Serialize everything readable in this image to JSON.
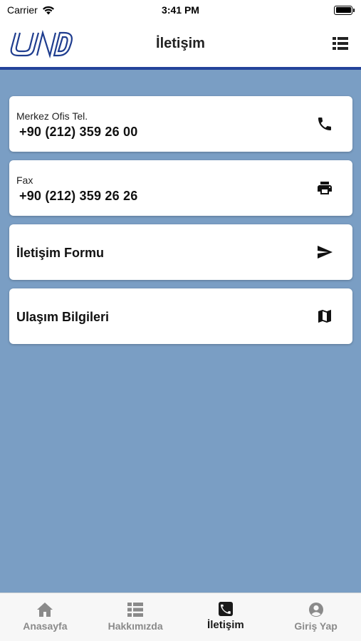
{
  "status_bar": {
    "carrier": "Carrier",
    "time": "3:41 PM"
  },
  "header": {
    "title": "İletişim",
    "logo_icon": "und-logo",
    "menu_icon": "list-icon",
    "accent_color": "#23439a"
  },
  "cards": [
    {
      "label": "Merkez Ofis Tel.",
      "value": "+90 (212) 359 26 00",
      "icon": "phone-icon"
    },
    {
      "label": "Fax",
      "value": "+90 (212) 359 26 26",
      "icon": "printer-icon"
    },
    {
      "title": "İletişim Formu",
      "icon": "send-icon"
    },
    {
      "title": "Ulaşım Bilgileri",
      "icon": "map-icon"
    }
  ],
  "tab_bar": {
    "tabs": [
      {
        "label": "Anasayfa",
        "icon": "home-icon",
        "active": false
      },
      {
        "label": "Hakkımızda",
        "icon": "list-icon",
        "active": false
      },
      {
        "label": "İletişim",
        "icon": "phone-square-icon",
        "active": true
      },
      {
        "label": "Giriş Yap",
        "icon": "user-circle-icon",
        "active": false
      }
    ]
  },
  "colors": {
    "background": "#7a9ec4",
    "card": "#ffffff",
    "tab_active": "#1a1a1a",
    "tab_inactive": "#8a8a8a"
  }
}
